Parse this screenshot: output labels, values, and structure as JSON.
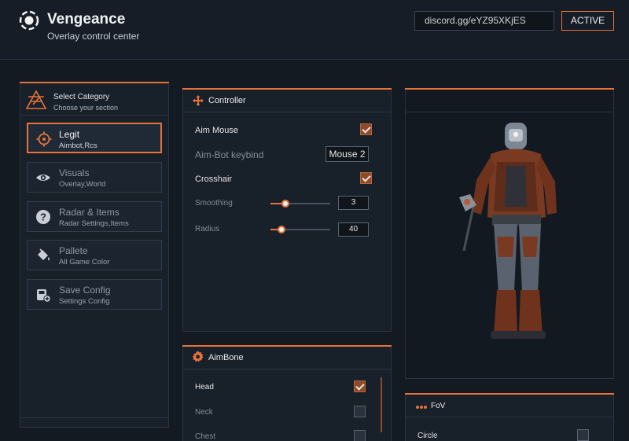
{
  "app": {
    "title": "Vengeance",
    "subtitle": "Overlay control center",
    "discord": "discord.gg/eYZ95XKjES",
    "status": "ACTIVE",
    "accent": "#e8733a"
  },
  "sidebar": {
    "title": "Select Category",
    "subtitle": "Choose your section",
    "items": [
      {
        "label": "Legit",
        "sub": "Aimbot,Rcs",
        "icon": "crosshair-icon",
        "selected": true
      },
      {
        "label": "Visuals",
        "sub": "Overlay,World",
        "icon": "eye-icon",
        "selected": false
      },
      {
        "label": "Radar & Items",
        "sub": "Radar Settings,Items",
        "icon": "question-icon",
        "selected": false
      },
      {
        "label": "Pallete",
        "sub": "All Game Color",
        "icon": "paint-bucket-icon",
        "selected": false
      },
      {
        "label": "Save Config",
        "sub": "Settings Config",
        "icon": "save-config-icon",
        "selected": false
      }
    ]
  },
  "controller": {
    "title": "Controller",
    "aim_mouse": {
      "label": "Aim Mouse",
      "checked": true
    },
    "keybind": {
      "label": "Aim-Bot keybind",
      "value": "Mouse 2"
    },
    "crosshair": {
      "label": "Crosshair",
      "checked": true
    },
    "smoothing": {
      "label": "Smoothing",
      "value": "3",
      "level": 0.25
    },
    "radius": {
      "label": "Radius",
      "value": "40",
      "level": 0.18
    }
  },
  "aimbone": {
    "title": "AimBone",
    "items": [
      {
        "label": "Head",
        "checked": true
      },
      {
        "label": "Neck",
        "checked": false
      },
      {
        "label": "Chest",
        "checked": false
      }
    ]
  },
  "fov": {
    "title": "FoV",
    "circle": {
      "label": "Circle",
      "checked": false
    }
  }
}
